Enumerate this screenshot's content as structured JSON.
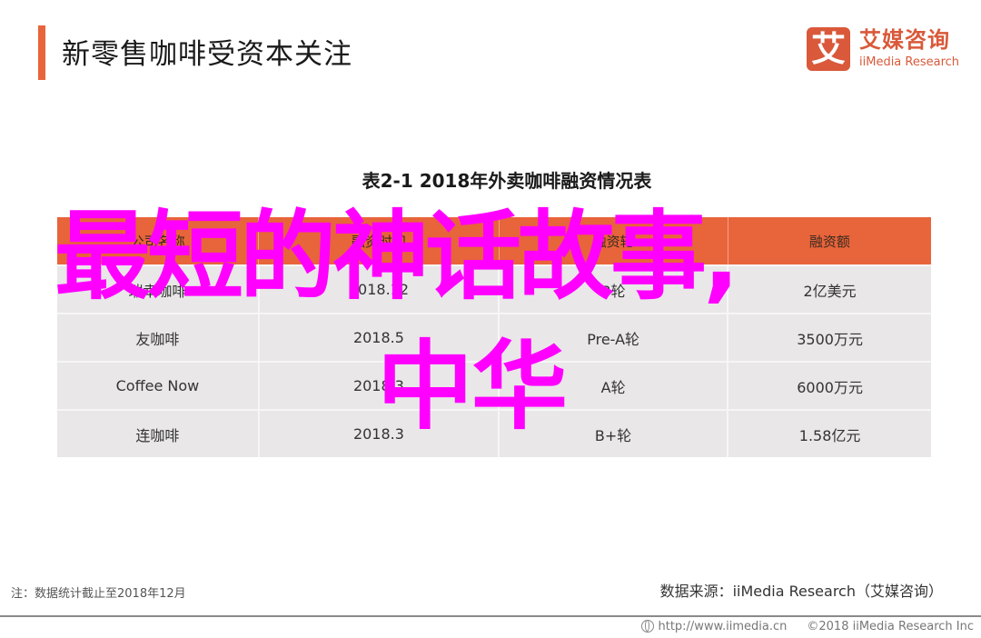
{
  "header": {
    "title": "新零售咖啡受资本关注",
    "accent_color": "#e8643a"
  },
  "logo": {
    "mark": "艾",
    "name_cn": "艾媒咨询",
    "name_en": "iiMedia Research",
    "brand_color": "#d9593a"
  },
  "table": {
    "title": "表2-1 2018年外卖咖啡融资情况表",
    "columns": [
      "公司名称",
      "融资时间",
      "融资轮",
      "融资额"
    ],
    "rows": [
      [
        "瑞幸咖啡",
        "2018.12",
        "B轮",
        "2亿美元"
      ],
      [
        "友咖啡",
        "2018.5",
        "Pre-A轮",
        "3500万元"
      ],
      [
        "Coffee Now",
        "2018.3",
        "A轮",
        "6000万元"
      ],
      [
        "连咖啡",
        "2018.3",
        "B+轮",
        "1.58亿元"
      ]
    ],
    "header_color": "#e8643a",
    "row_color": "#e9e7e8"
  },
  "overlay": {
    "line1": "最短的神话故事,",
    "line2": "中华",
    "color": "#ff00ff"
  },
  "note": "注：数据统计截止至2018年12月",
  "source": "数据来源：iiMedia Research（艾媒咨询）",
  "footer": {
    "icon": "globe-icon",
    "url": "http://www.iimedia.cn",
    "copyright": "©2018  iiMedia Research  Inc"
  }
}
